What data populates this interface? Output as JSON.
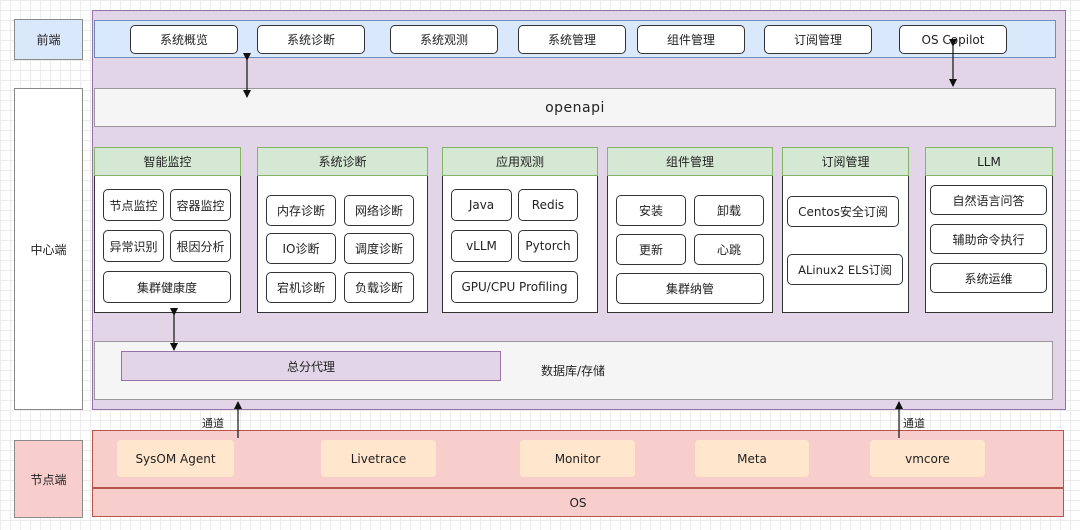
{
  "lanes": {
    "frontend": "前端",
    "center": "中心端",
    "node": "节点端"
  },
  "frontend_tabs": [
    "系统概览",
    "系统诊断",
    "系统观测",
    "系统管理",
    "组件管理",
    "订阅管理",
    "OS Copilot"
  ],
  "openapi": "openapi",
  "modules": [
    {
      "title": "智能监控",
      "items": [
        "节点监控",
        "容器监控",
        "异常识别",
        "根因分析",
        "集群健康度"
      ]
    },
    {
      "title": "系统诊断",
      "items": [
        "内存诊断",
        "网络诊断",
        "IO诊断",
        "调度诊断",
        "宕机诊断",
        "负载诊断"
      ]
    },
    {
      "title": "应用观测",
      "items": [
        "Java",
        "Redis",
        "vLLM",
        "Pytorch",
        "GPU/CPU Profiling"
      ]
    },
    {
      "title": "组件管理",
      "items": [
        "安装",
        "卸载",
        "更新",
        "心跳",
        "集群纳管"
      ]
    },
    {
      "title": "订阅管理",
      "items": [
        "Centos安全订阅",
        "ALinux2 ELS订阅"
      ]
    },
    {
      "title": "LLM",
      "items": [
        "自然语言问答",
        "辅助命令执行",
        "系统运维"
      ]
    }
  ],
  "proxy": "总分代理",
  "storage": "数据库/存储",
  "channel": "通道",
  "agents": [
    "SysOM Agent",
    "Livetrace",
    "Monitor",
    "Meta",
    "vmcore"
  ],
  "os": "OS"
}
